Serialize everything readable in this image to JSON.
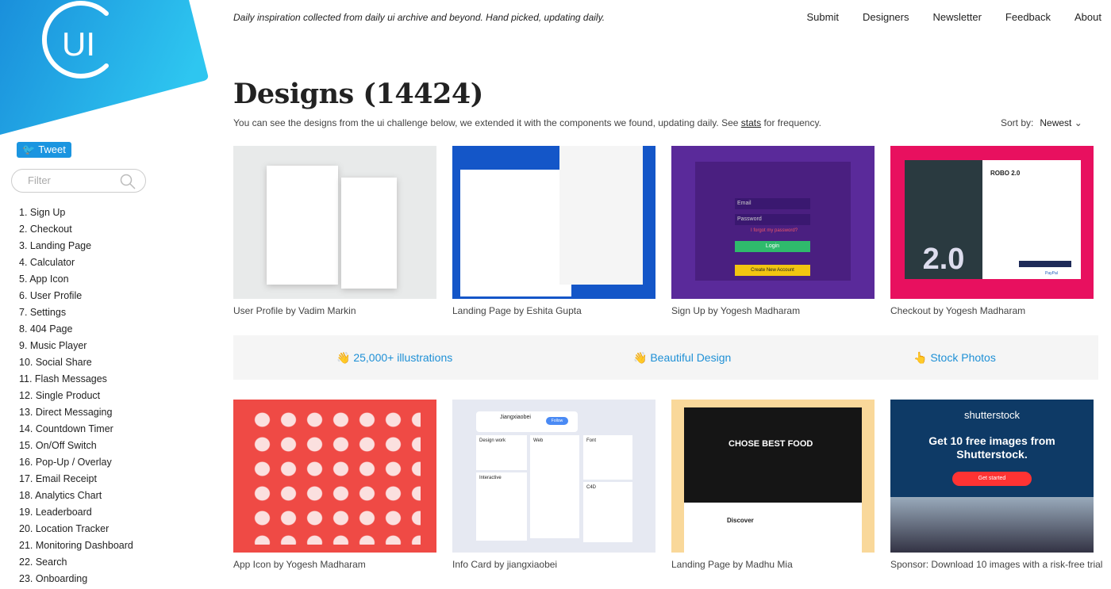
{
  "brand": {
    "logo_text": "UI",
    "colors": {
      "logo_from": "#1a8fdb",
      "logo_to": "#2ec6f0",
      "accent": "#1e90d6"
    }
  },
  "tweet_label": "Tweet",
  "filter": {
    "placeholder": "Filter"
  },
  "sidebar": [
    "1. Sign Up",
    "2. Checkout",
    "3. Landing Page",
    "4. Calculator",
    "5. App Icon",
    "6. User Profile",
    "7. Settings",
    "8. 404 Page",
    "9. Music Player",
    "10. Social Share",
    "11. Flash Messages",
    "12. Single Product",
    "13. Direct Messaging",
    "14. Countdown Timer",
    "15. On/Off Switch",
    "16. Pop-Up / Overlay",
    "17. Email Receipt",
    "18. Analytics Chart",
    "19. Leaderboard",
    "20. Location Tracker",
    "21. Monitoring Dashboard",
    "22. Search",
    "23. Onboarding"
  ],
  "tagline": "Daily inspiration collected from daily ui archive and beyond. Hand picked, updating daily.",
  "nav": [
    "Submit",
    "Designers",
    "Newsletter",
    "Feedback",
    "About"
  ],
  "title": "Designs (14424)",
  "subtitle": {
    "before": "You can see the designs from the ui challenge below, we extended it with the components we found, updating daily. See ",
    "link": "stats",
    "after": " for frequency."
  },
  "sort": {
    "label": "Sort by:",
    "value": "Newest"
  },
  "cards": [
    {
      "caption": "User Profile by Vadim Markin",
      "bg": "#e8eaea"
    },
    {
      "caption": "Landing Page by Eshita Gupta",
      "bg": "#1456c8"
    },
    {
      "caption": "Sign Up by Yogesh Madharam",
      "bg": "#5a2a9a",
      "thumb": {
        "email": "Email",
        "password": "Password",
        "forgot": "I forgot my password?",
        "login": "Login",
        "create": "Create New Account"
      }
    },
    {
      "caption": "Checkout by Yogesh Madharam",
      "bg": "#e8105f",
      "thumb": {
        "title": "ROBO 2.0",
        "poster": "2.0",
        "pay": "PayPal"
      }
    },
    {
      "caption": "App Icon by Yogesh Madharam",
      "bg": "#ef4a45"
    },
    {
      "caption": "Info Card by jiangxiaobei",
      "bg": "#e6e9f2",
      "thumb": {
        "name": "Jiangxiaobei",
        "follow": "Follow",
        "design": "Design work",
        "web": "Web",
        "font": "Font",
        "interactive": "Interactive",
        "c4d": "C4D"
      }
    },
    {
      "caption": "Landing Page by Madhu Mia",
      "bg": "#f9d89a",
      "thumb": {
        "headline": "CHOSE BEST FOOD",
        "discover": "Discover"
      }
    },
    {
      "caption": "Sponsor: Download 10 images with a risk-free trial",
      "bg": "#0e3a66",
      "thumb": {
        "brand": "shutterstock",
        "headline": "Get 10 free images from Shutterstock.",
        "cta": "Get started"
      }
    }
  ],
  "promo": [
    {
      "icon": "hand-icon",
      "label": "25,000+ illustrations"
    },
    {
      "icon": "hand-icon",
      "label": "Beautiful Design"
    },
    {
      "icon": "hand-pointer-icon",
      "label": "Stock Photos"
    }
  ]
}
